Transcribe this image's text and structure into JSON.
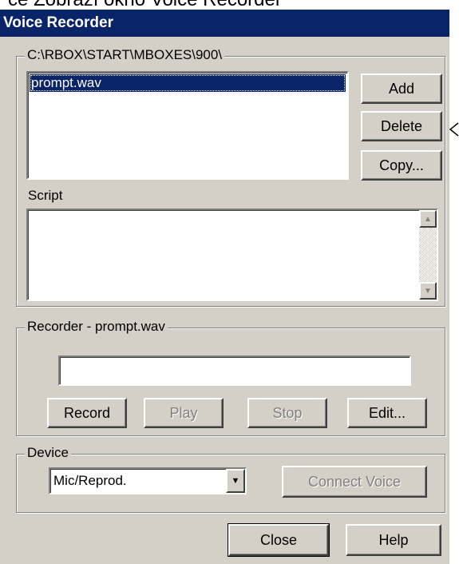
{
  "caption": "ce Zobrazí okno Voice Recorder",
  "window": {
    "title": "Voice Recorder"
  },
  "files_group": {
    "path_label": "C:\\RBOX\\START\\MBOXES\\900\\",
    "files": [
      "prompt.wav"
    ],
    "selected_index": 0,
    "buttons": {
      "add": "Add",
      "delete": "Delete",
      "copy": "Copy..."
    },
    "script_label": "Script",
    "script_text": ""
  },
  "recorder_group": {
    "label": "Recorder - prompt.wav",
    "level_value": "",
    "buttons": {
      "record": "Record",
      "play": "Play",
      "stop": "Stop",
      "edit": "Edit..."
    }
  },
  "device_group": {
    "label": "Device",
    "selected_device": "Mic/Reprod.",
    "connect_button": "Connect Voice"
  },
  "footer": {
    "close": "Close",
    "help": "Help"
  },
  "icons": {
    "scroll_up": "scroll-up-arrow-icon",
    "scroll_down": "scroll-down-arrow-icon",
    "dropdown": "dropdown-arrow-icon",
    "pointer": "callout-arrow-icon"
  },
  "colors": {
    "titlebar": "#0a246a",
    "dialog_bg": "#d4d0c8",
    "selection": "#0a246a",
    "disabled_text": "#808080"
  }
}
